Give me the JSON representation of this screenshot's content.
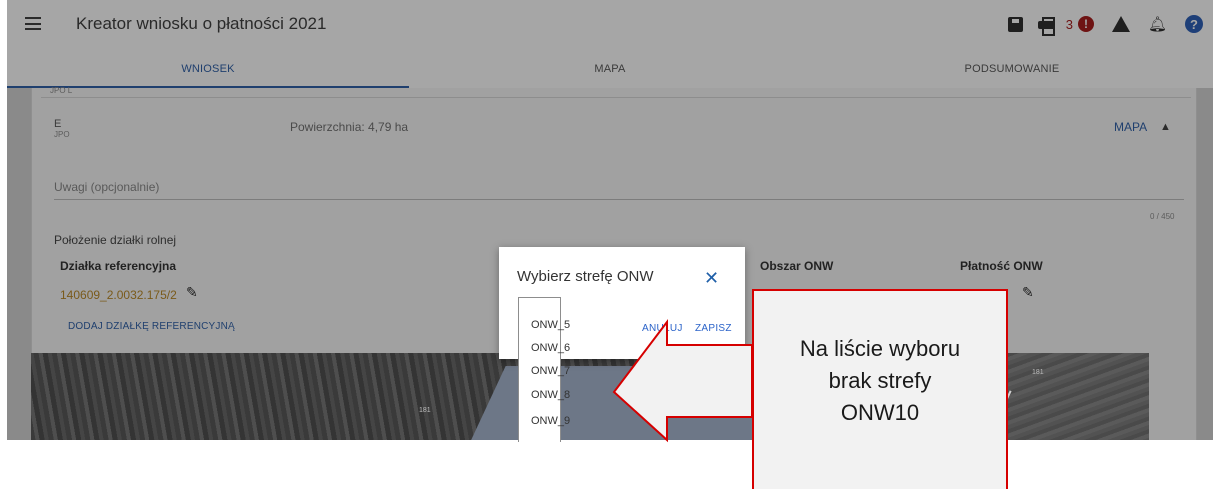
{
  "app": {
    "title": "Kreator wniosku o płatności 2021",
    "error_count": "3",
    "error_badge": "!",
    "help_badge": "?"
  },
  "tabs": [
    {
      "label": "WNIOSEK",
      "active": true
    },
    {
      "label": "MAPA",
      "active": false
    },
    {
      "label": "PODSUMOWANIE",
      "active": false
    }
  ],
  "row_prev": {
    "code": "JPO L"
  },
  "row": {
    "letter": "E",
    "code": "JPO",
    "area": "Powierzchnia: 4,79 ha",
    "map_link": "MAPA"
  },
  "notes": {
    "placeholder": "Uwagi (opcjonalnie)",
    "counter": "0 / 450"
  },
  "location": {
    "title": "Położenie działki rolnej",
    "col_ref": "Działka referencyjna",
    "col_area": "Obszar ONW",
    "col_payment": "Płatność ONW",
    "parcel_id": "140609_2.0032.175/2",
    "add_parcel": "DODAJ DZIAŁKĘ REFERENCYJNĄ"
  },
  "map": {
    "parcel_label_1": "181",
    "parcel_label_2": "181"
  },
  "dialog": {
    "title": "Wybierz strefę ONW",
    "cancel": "ANULUJ",
    "save": "ZAPISZ",
    "options": [
      "ONW_5",
      "ONW_6",
      "ONW_7",
      "ONW_8",
      "ONW_9"
    ]
  },
  "callout": {
    "lines": [
      "Na liście wyboru",
      "brak strefy",
      "ONW10"
    ]
  },
  "colors": {
    "accent": "#1f3f6e",
    "error": "#6e1313",
    "callout_border": "#d60000"
  }
}
